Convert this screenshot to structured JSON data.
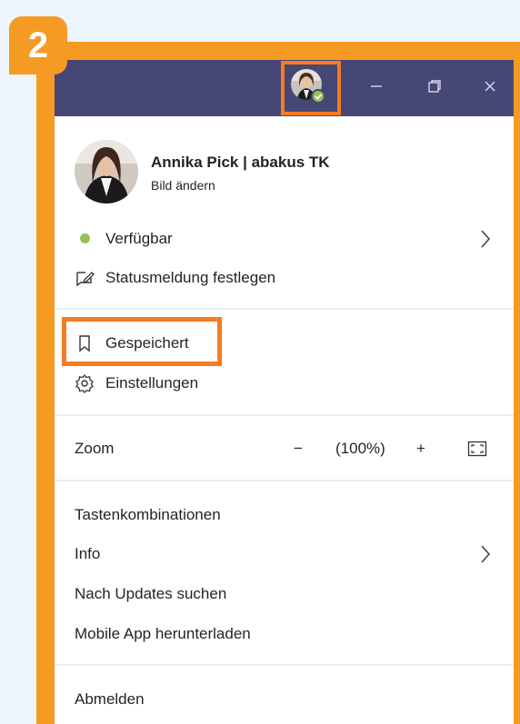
{
  "step_badge": "2",
  "titlebar": {
    "minimize_icon": "minimize-icon",
    "restore_icon": "restore-icon",
    "close_icon": "close-icon"
  },
  "profile": {
    "name": "Annika Pick | abakus TK",
    "change_picture": "Bild ändern"
  },
  "status": {
    "availability": "Verfügbar",
    "set_status_message": "Statusmeldung festlegen"
  },
  "menu": {
    "saved": "Gespeichert",
    "settings": "Einstellungen",
    "zoom_label": "Zoom",
    "zoom_value": "(100%)",
    "zoom_minus": "−",
    "zoom_plus": "+",
    "keyboard_shortcuts": "Tastenkombinationen",
    "info": "Info",
    "check_updates": "Nach Updates suchen",
    "mobile_app": "Mobile App herunterladen",
    "sign_out": "Abmelden"
  },
  "colors": {
    "highlight": "#f57c22",
    "titlebar": "#464775",
    "presence_available": "#92c353"
  }
}
